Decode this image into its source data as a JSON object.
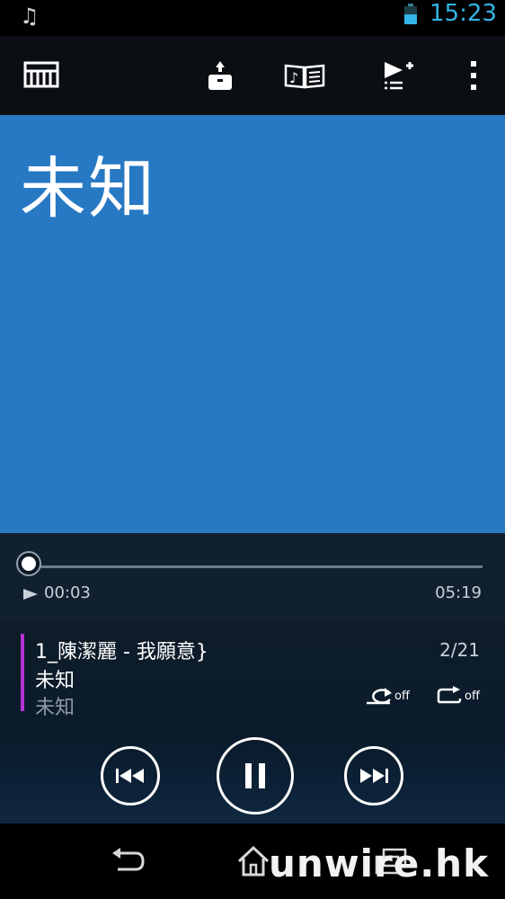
{
  "status_bar": {
    "notification_icon": "music-note-icon",
    "time": "15:23",
    "battery_icon": "battery-icon"
  },
  "toolbar": {
    "items": [
      {
        "name": "library-button",
        "icon": "library-icon"
      },
      {
        "name": "share-button",
        "icon": "share-icon"
      },
      {
        "name": "lyrics-button",
        "icon": "lyrics-icon"
      },
      {
        "name": "add-to-playlist-button",
        "icon": "playlist-add-icon"
      },
      {
        "name": "overflow-menu-button",
        "icon": "more-vert-icon"
      }
    ]
  },
  "album_art": {
    "title": "未知",
    "background": "#2779c4"
  },
  "progress": {
    "current_time": "00:03",
    "total_time": "05:19",
    "fraction": 0.01
  },
  "now_playing": {
    "song_title": "1_陳潔麗 -  我願意}",
    "track_position": "2/21",
    "album": "未知",
    "artist": "未知",
    "accent_color": "#b533d6",
    "shuffle": {
      "icon": "shuffle-icon",
      "label": "off"
    },
    "repeat": {
      "icon": "repeat-icon",
      "label": "off"
    }
  },
  "controls": {
    "prev_icon": "skip-previous-icon",
    "pause_icon": "pause-icon",
    "next_icon": "skip-next-icon"
  },
  "nav_bar": {
    "back_icon": "back-icon",
    "home_icon": "home-icon",
    "recents_icon": "recents-icon"
  },
  "watermark": "unwire.hk"
}
